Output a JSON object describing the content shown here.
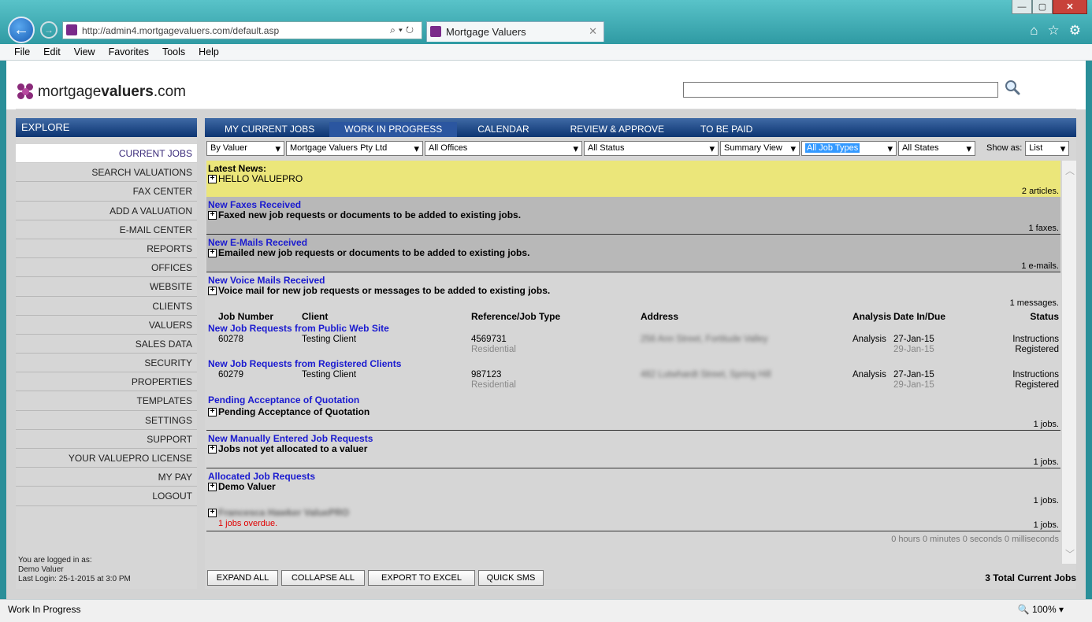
{
  "browser": {
    "url": "http://admin4.mortgagevaluers.com/default.asp",
    "tab_title": "Mortgage Valuers",
    "menu": [
      "File",
      "Edit",
      "View",
      "Favorites",
      "Tools",
      "Help"
    ],
    "status": "Work In Progress",
    "zoom": "100%"
  },
  "logo": {
    "prefix": "mortgage",
    "bold": "valuers",
    "suffix": ".com"
  },
  "sidebar": {
    "header": "EXPLORE",
    "items": [
      "CURRENT JOBS",
      "SEARCH VALUATIONS",
      "FAX CENTER",
      "ADD A VALUATION",
      "E-MAIL CENTER",
      "REPORTS",
      "OFFICES",
      "WEBSITE",
      "CLIENTS",
      "VALUERS",
      "SALES DATA",
      "SECURITY",
      "PROPERTIES",
      "TEMPLATES",
      "SETTINGS",
      "SUPPORT",
      "YOUR VALUEPRO LICENSE",
      "MY PAY",
      "LOGOUT"
    ],
    "login_line1": "You are logged in as:",
    "login_line2": "Demo Valuer",
    "login_line3": "Last Login: 25-1-2015 at 3:0 PM"
  },
  "tabs": [
    "MY CURRENT JOBS",
    "WORK IN PROGRESS",
    "CALENDAR",
    "REVIEW & APPROVE",
    "TO BE PAID"
  ],
  "filters": {
    "by_valuer": "By Valuer",
    "company": "Mortgage Valuers Pty Ltd",
    "offices": "All Offices",
    "status": "All Status",
    "view": "Summary View",
    "job_types": "All Job Types",
    "states": "All States",
    "show_as_label": "Show as:",
    "show_as": "List"
  },
  "news": {
    "title": "Latest News:",
    "item": "HELLO VALUEPRO",
    "count": "2 articles."
  },
  "faxes": {
    "title": "New Faxes Received",
    "desc": "Faxed new job requests or documents to be added to existing jobs.",
    "count": "1 faxes."
  },
  "emails": {
    "title": "New E-Mails Received",
    "desc": "Emailed new job requests or documents to be added to existing jobs.",
    "count": "1 e-mails."
  },
  "voicemails": {
    "title": "New Voice Mails Received",
    "desc": "Voice mail for new job requests or messages to be added to existing jobs.",
    "count": "1 messages."
  },
  "table_headers": [
    "Job Number",
    "Client",
    "Reference/Job Type",
    "Address",
    "Analysis",
    "Date In/Due",
    "Status"
  ],
  "public_requests": {
    "title": "New Job Requests from Public Web Site",
    "job": {
      "number": "60278",
      "client": "Testing Client",
      "ref": "4569731",
      "type": "Residential",
      "address": "256 Ann Street, Fortitude Valley",
      "analysis": "Analysis",
      "date_in": "27-Jan-15",
      "due": "29-Jan-15",
      "status1": "Instructions",
      "status2": "Registered"
    }
  },
  "registered_requests": {
    "title": "New Job Requests from Registered Clients",
    "job": {
      "number": "60279",
      "client": "Testing Client",
      "ref": "987123",
      "type": "Residential",
      "address": "482 Lutwhardt Street, Spring Hill",
      "analysis": "Analysis",
      "date_in": "27-Jan-15",
      "due": "29-Jan-15",
      "status1": "Instructions",
      "status2": "Registered"
    }
  },
  "pending": {
    "title": "Pending Acceptance of Quotation",
    "desc": "Pending Acceptance of Quotation",
    "count": "1 jobs."
  },
  "manual": {
    "title": "New Manually Entered Job Requests",
    "desc": "Jobs not yet allocated to a valuer",
    "count": "1 jobs."
  },
  "allocated": {
    "title": "Allocated Job Requests",
    "desc": "Demo Valuer",
    "count": "1 jobs.",
    "hidden_name": "Francesca Hawker ValuePRO",
    "overdue": "1 jobs overdue.",
    "count2": "1 jobs."
  },
  "timer": "0 hours 0 minutes 0 seconds 0 milliseconds",
  "buttons": [
    "EXPAND ALL",
    "COLLAPSE ALL",
    "EXPORT TO EXCEL",
    "QUICK SMS"
  ],
  "total": "3 Total Current Jobs",
  "colors": {
    "nav_blue": "#0c3472",
    "link_blue": "#1a1ad0",
    "news_yellow": "#ebe67a",
    "overdue_red": "#e00000"
  }
}
